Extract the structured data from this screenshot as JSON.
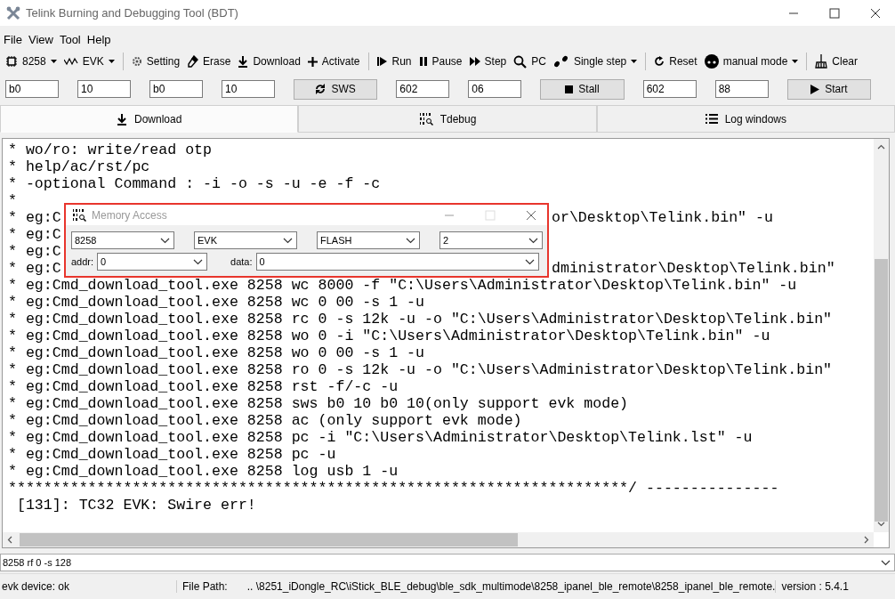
{
  "window": {
    "title": "Telink Burning and Debugging Tool (BDT)"
  },
  "menu": [
    "File",
    "View",
    "Tool",
    "Help"
  ],
  "toolbar": [
    {
      "kind": "dropdown",
      "label": "8258"
    },
    {
      "kind": "dropdown",
      "label": "EVK"
    },
    {
      "kind": "separator"
    },
    {
      "kind": "button",
      "label": "Setting"
    },
    {
      "kind": "button",
      "label": "Erase"
    },
    {
      "kind": "button",
      "label": "Download"
    },
    {
      "kind": "button",
      "label": "Activate"
    },
    {
      "kind": "separator"
    },
    {
      "kind": "button",
      "label": "Run"
    },
    {
      "kind": "button",
      "label": "Pause"
    },
    {
      "kind": "button",
      "label": "Step"
    },
    {
      "kind": "button",
      "label": "PC"
    },
    {
      "kind": "dropdown",
      "label": "Single step"
    },
    {
      "kind": "separator"
    },
    {
      "kind": "button",
      "label": "Reset"
    },
    {
      "kind": "dropdown",
      "label": "manual mode"
    },
    {
      "kind": "separator"
    },
    {
      "kind": "button",
      "label": "Clear"
    }
  ],
  "control_row": [
    {
      "kind": "field",
      "value": "b0"
    },
    {
      "kind": "field",
      "value": "10"
    },
    {
      "kind": "field",
      "value": "b0"
    },
    {
      "kind": "field",
      "value": "10"
    },
    {
      "kind": "button",
      "label": "SWS"
    },
    {
      "kind": "field",
      "value": "602"
    },
    {
      "kind": "field",
      "value": "06"
    },
    {
      "kind": "button",
      "label": "Stall"
    },
    {
      "kind": "field",
      "value": "602"
    },
    {
      "kind": "field",
      "value": "88"
    },
    {
      "kind": "button",
      "label": "Start"
    }
  ],
  "tabs": [
    {
      "label": "Download",
      "selected": true
    },
    {
      "label": "Tdebug",
      "selected": false
    },
    {
      "label": "Log windows",
      "selected": false
    }
  ],
  "console": {
    "lines": [
      {
        "text": "* wo/ro: write/read otp"
      },
      {
        "text": "* help/ac/rst/pc"
      },
      {
        "text": "* -optional Command : -i -o -s -u -e -f -c"
      },
      {
        "text": "*"
      },
      {
        "left": "* eg:C",
        "right": "or\\Desktop\\Telink.bin\" -u"
      },
      {
        "left": "* eg:C"
      },
      {
        "left": "* eg:C"
      },
      {
        "left": "* eg:C",
        "right": "dministrator\\Desktop\\Telink.bin\""
      },
      {
        "text": "* eg:Cmd_download_tool.exe 8258 wc 8000 -f \"C:\\Users\\Administrator\\Desktop\\Telink.bin\" -u"
      },
      {
        "text": "* eg:Cmd_download_tool.exe 8258 wc 0 00 -s 1 -u"
      },
      {
        "text": "* eg:Cmd_download_tool.exe 8258 rc 0 -s 12k -u -o \"C:\\Users\\Administrator\\Desktop\\Telink.bin\""
      },
      {
        "text": "* eg:Cmd_download_tool.exe 8258 wo 0 -i \"C:\\Users\\Administrator\\Desktop\\Telink.bin\" -u"
      },
      {
        "text": "* eg:Cmd_download_tool.exe 8258 wo 0 00 -s 1 -u"
      },
      {
        "text": "* eg:Cmd_download_tool.exe 8258 ro 0 -s 12k -u -o \"C:\\Users\\Administrator\\Desktop\\Telink.bin\""
      },
      {
        "text": "* eg:Cmd_download_tool.exe 8258 rst -f/-c -u"
      },
      {
        "text": "* eg:Cmd_download_tool.exe 8258 sws b0 10 b0 10(only support evk mode)"
      },
      {
        "text": "* eg:Cmd_download_tool.exe 8258 ac (only support evk mode)"
      },
      {
        "text": "* eg:Cmd_download_tool.exe 8258 pc -i \"C:\\Users\\Administrator\\Desktop\\Telink.lst\" -u"
      },
      {
        "text": "* eg:Cmd_download_tool.exe 8258 pc -u"
      },
      {
        "text": "* eg:Cmd_download_tool.exe 8258 log usb 1 -u"
      },
      {
        "text": "**********************************************************************/ ---------------"
      },
      {
        "text": " [131]: TC32 EVK: Swire err!"
      }
    ]
  },
  "dialog": {
    "title": "Memory Access",
    "selects": [
      {
        "value": "8258"
      },
      {
        "value": "EVK"
      },
      {
        "value": "FLASH"
      },
      {
        "value": "2"
      }
    ],
    "addr": {
      "label": "addr:",
      "value": "0"
    },
    "data": {
      "label": "data:",
      "value": "0"
    }
  },
  "command": {
    "value": "8258 rf 0 -s 128"
  },
  "status_bar": {
    "device": "evk device: ok",
    "path_label": "File Path:",
    "path": "..  \\8251_iDongle_RC\\iStick_BLE_debug\\ble_sdk_multimode\\8258_ipanel_ble_remote\\8258_ipanel_ble_remote.",
    "version": "version : 5.4.1"
  }
}
